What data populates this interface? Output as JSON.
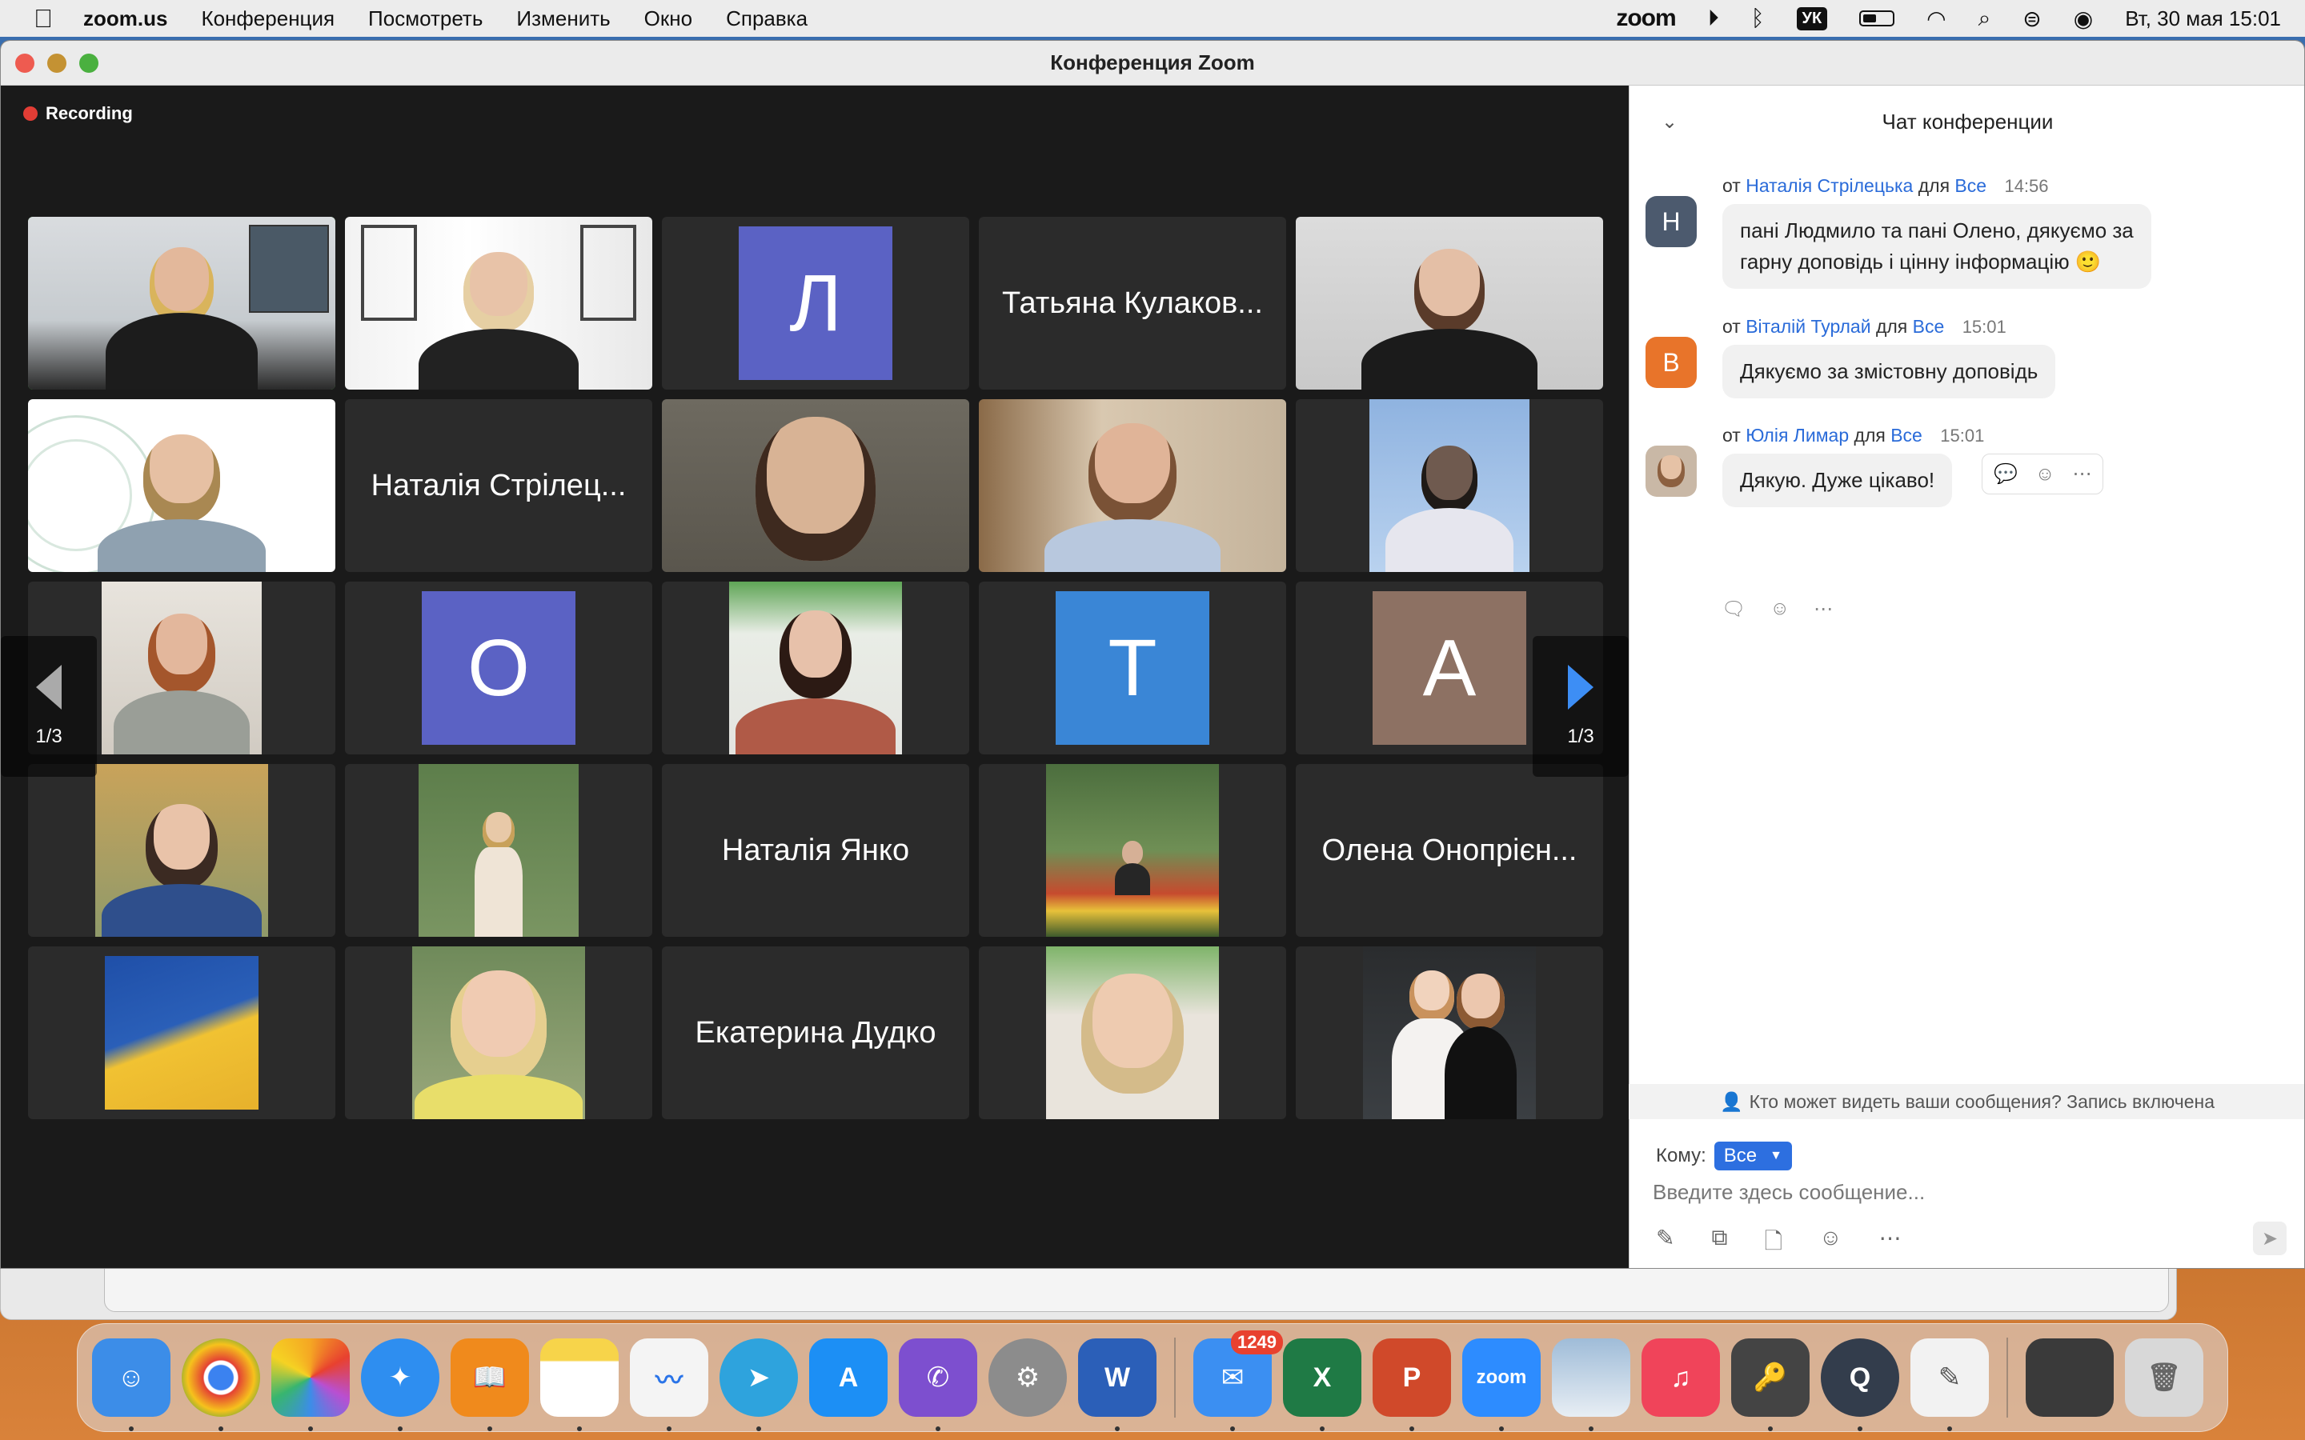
{
  "menubar": {
    "app_name": "zoom.us",
    "menus": [
      "Конференция",
      "Посмотреть",
      "Изменить",
      "Окно",
      "Справка"
    ],
    "zoom_word": "zoom",
    "keyboard_layout": "УК",
    "datetime": "Вт, 30 мая  15:01"
  },
  "window": {
    "title": "Конференция Zoom",
    "recording_label": "Recording"
  },
  "pager": {
    "left_label": "1/3",
    "right_label": "1/3"
  },
  "tiles": [
    {
      "kind": "photo"
    },
    {
      "kind": "photo"
    },
    {
      "kind": "letter",
      "letter": "Л",
      "color": "#5b62c4"
    },
    {
      "kind": "name",
      "name": "Татьяна Кулаков..."
    },
    {
      "kind": "photo"
    },
    {
      "kind": "photo"
    },
    {
      "kind": "name",
      "name": "Наталія Стрілец..."
    },
    {
      "kind": "photo"
    },
    {
      "kind": "photo"
    },
    {
      "kind": "photo"
    },
    {
      "kind": "photo"
    },
    {
      "kind": "letter",
      "letter": "О",
      "color": "#5b62c4"
    },
    {
      "kind": "photo"
    },
    {
      "kind": "letter",
      "letter": "Т",
      "color": "#3a86d6"
    },
    {
      "kind": "letter",
      "letter": "А",
      "color": "#8d7163"
    },
    {
      "kind": "photo"
    },
    {
      "kind": "photo"
    },
    {
      "kind": "name",
      "name": "Наталія Янко"
    },
    {
      "kind": "photo"
    },
    {
      "kind": "name",
      "name": "Олена Онопрієн..."
    },
    {
      "kind": "photo"
    },
    {
      "kind": "photo"
    },
    {
      "kind": "name",
      "name": "Екатерина Дудко"
    },
    {
      "kind": "photo"
    },
    {
      "kind": "photo"
    }
  ],
  "chat": {
    "title": "Чат конференции",
    "from_word": "от",
    "for_word": "для",
    "messages": [
      {
        "avatar": "Н",
        "avatar_color": "#4c5a6e",
        "sender": "Наталія Стрілецька",
        "recipient": "Все",
        "time": "14:56",
        "text_line1": "пані Людмило та пані Олено, дякуємо за",
        "text_line2": "гарну доповідь і цінну інформацію 🙂"
      },
      {
        "avatar": "В",
        "avatar_color": "#e8742a",
        "sender": "Віталій Турлай",
        "recipient": "Все",
        "time": "15:01",
        "text_line1": "Дякуємо за змістовну доповідь"
      },
      {
        "avatar": "",
        "avatar_color": "#c9b8a6",
        "sender": "Юлія Лимар",
        "recipient": "Все",
        "time": "15:01",
        "text_line1": "Дякую. Дуже цікаво!"
      }
    ],
    "who_can_see": "Кто может видеть ваши сообщения? Запись включена",
    "to_label": "Кому:",
    "to_value": "Все",
    "input_placeholder": "Введите здесь сообщение..."
  },
  "dock": {
    "apps": [
      {
        "name": "Finder",
        "color": "#3c8de8",
        "label": ""
      },
      {
        "name": "Chrome",
        "color": "#f1f1f1",
        "label": ""
      },
      {
        "name": "Photos",
        "color": "#f5f5f5",
        "label": ""
      },
      {
        "name": "Safari",
        "color": "#2e8ef0",
        "label": ""
      },
      {
        "name": "Books",
        "color": "#f08a1c",
        "label": ""
      },
      {
        "name": "Notes",
        "color": "#f7d44a",
        "label": ""
      },
      {
        "name": "Freeform",
        "color": "#f4f4f4",
        "label": ""
      },
      {
        "name": "Telegram",
        "color": "#2ea3dd",
        "label": ""
      },
      {
        "name": "App Store",
        "color": "#1c8ff5",
        "label": ""
      },
      {
        "name": "Viber",
        "color": "#7d4fcf",
        "label": ""
      },
      {
        "name": "System Settings",
        "color": "#8c8c8c",
        "label": ""
      },
      {
        "name": "Word",
        "color": "#2b5fb8",
        "label": "W"
      },
      {
        "name": "Mail",
        "color": "#3b8ff2",
        "label": "",
        "badge": "1249"
      },
      {
        "name": "Excel",
        "color": "#1f7a45",
        "label": "X"
      },
      {
        "name": "PowerPoint",
        "color": "#d0492a",
        "label": "P"
      },
      {
        "name": "Zoom",
        "color": "#2d8cff",
        "label": "zoom"
      },
      {
        "name": "Preview",
        "color": "#9fbcd8",
        "label": ""
      },
      {
        "name": "Music",
        "color": "#f0445a",
        "label": "♫"
      },
      {
        "name": "Keychain",
        "color": "#444444",
        "label": ""
      },
      {
        "name": "QuickTime",
        "color": "#333d4c",
        "label": ""
      },
      {
        "name": "TextEdit",
        "color": "#f2f2f2",
        "label": ""
      },
      {
        "name": "Screenshot",
        "color": "#3a3a3a",
        "label": ""
      },
      {
        "name": "Trash",
        "color": "#d8d8d8",
        "label": ""
      }
    ]
  }
}
